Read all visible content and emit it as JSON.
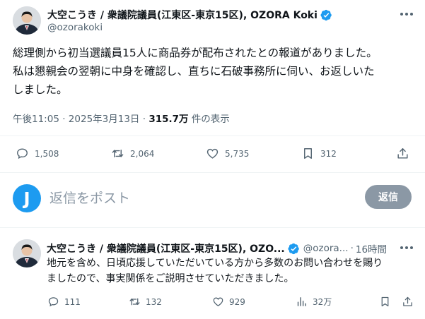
{
  "post": {
    "author_name": "大空こうき / 衆議院議員(江東区-東京15区), OZORA Koki",
    "handle": "@ozorakoki",
    "text_lines": [
      "総理側から初当選議員15人に商品券が配布されたとの報道がありました。",
      "私は懇親会の翌朝に中身を確認し、直ちに石破事務所に伺い、お返しいた",
      "しました。"
    ],
    "time": "午後11:05",
    "date": "2025年3月13日",
    "views": "315.7万",
    "views_label": "件の表示",
    "stats": {
      "replies": "1,508",
      "reposts": "2,064",
      "likes": "5,735",
      "bookmarks": "312"
    }
  },
  "composer": {
    "avatar_letter": "J",
    "placeholder": "返信をポスト",
    "reply_button": "返信"
  },
  "reply_post": {
    "author_name": "大空こうき / 衆議院議員(江東区-東京15区), OZO...",
    "handle": "@ozora...",
    "time_ago": "16時間",
    "text_lines": [
      "地元を含め、日頃応援していただいている方から多数のお問い合わせを賜り",
      "ましたので、事実関係をご説明させていただきました。"
    ],
    "stats": {
      "replies": "111",
      "reposts": "132",
      "likes": "929",
      "views": "32万"
    }
  },
  "colors": {
    "verified": "#1d9bf0",
    "text_primary": "#0f1419",
    "text_secondary": "#536471",
    "reply_button_bg": "#8b98a5"
  }
}
